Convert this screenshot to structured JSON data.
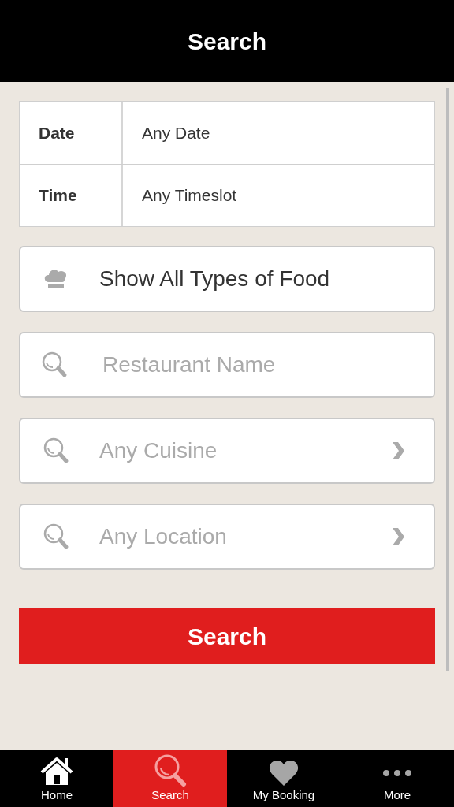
{
  "header": {
    "title": "Search"
  },
  "when_table": {
    "rows": [
      {
        "label": "Date",
        "value": "Any Date"
      },
      {
        "label": "Time",
        "value": "Any Timeslot"
      }
    ]
  },
  "food_type_button": {
    "label": "Show All Types of Food"
  },
  "fields": [
    {
      "kind": "input",
      "placeholder": "Restaurant Name"
    },
    {
      "kind": "picker",
      "placeholder": "Any Cuisine"
    },
    {
      "kind": "picker",
      "placeholder": "Any Location"
    }
  ],
  "search_button": {
    "label": "Search"
  },
  "tab_bar": [
    {
      "label": "Home",
      "selected": false
    },
    {
      "label": "Search",
      "selected": true
    },
    {
      "label": "My Booking",
      "selected": false
    },
    {
      "label": "More",
      "selected": false
    }
  ]
}
